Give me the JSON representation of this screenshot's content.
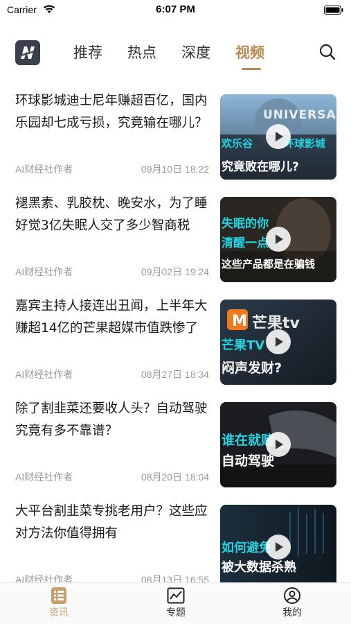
{
  "status_bar": {
    "carrier": "Carrier",
    "time": "6:07 PM"
  },
  "nav": {
    "tabs": [
      {
        "label": "推荐",
        "active": false
      },
      {
        "label": "热点",
        "active": false
      },
      {
        "label": "深度",
        "active": false
      },
      {
        "label": "视频",
        "active": true
      }
    ]
  },
  "colors": {
    "accent": "#b98a52",
    "tab_active_label": "#c9a06d",
    "meta_text": "#9a9a9a"
  },
  "articles": [
    {
      "title": "环球影城迪士尼年赚超百亿，国内乐园却七成亏损，究竟输在哪儿？",
      "author": "AI财经社作者",
      "time": "09月10日 18:22",
      "thumb_text": {
        "line1": "欢乐谷",
        "line2": "环球影城",
        "line3": "究竟败在哪儿?",
        "logo": "UNIVERSAL"
      }
    },
    {
      "title": "褪黑素、乳胶枕、晚安水，为了睡好觉3亿失眠人交了多少智商税",
      "author": "AI财经社作者",
      "time": "09月02日 19:24",
      "thumb_text": {
        "line1": "失眠的你",
        "line2": "清醒一点",
        "line3": "这些产品都是在骗钱"
      }
    },
    {
      "title": "嘉宾主持人接连出丑闻，上半年大赚超14亿的芒果超媒市值跌惨了",
      "author": "AI财经社作者",
      "time": "08月27日 18:34",
      "thumb_text": {
        "line1": "芒果tv",
        "line2": "芒果TV",
        "line3": "闷声发财?"
      }
    },
    {
      "title": "除了割韭菜还要收人头？自动驾驶究竟有多不靠谱？",
      "author": "AI财经社作者",
      "time": "08月20日 18:04",
      "thumb_text": {
        "line1": "谁在就赌",
        "line2": "自动驾驶"
      }
    },
    {
      "title": "大平台割韭菜专挑老用户？这些应对方法你值得拥有",
      "author": "AI财经社作者",
      "time": "08月13日 16:55",
      "thumb_text": {
        "line1": "如何避免",
        "line2": "被大数据杀熟"
      }
    }
  ],
  "tabbar": {
    "items": [
      {
        "label": "资讯",
        "icon": "news-icon",
        "active": true
      },
      {
        "label": "专题",
        "icon": "chart-icon",
        "active": false
      },
      {
        "label": "我的",
        "icon": "profile-icon",
        "active": false
      }
    ]
  }
}
